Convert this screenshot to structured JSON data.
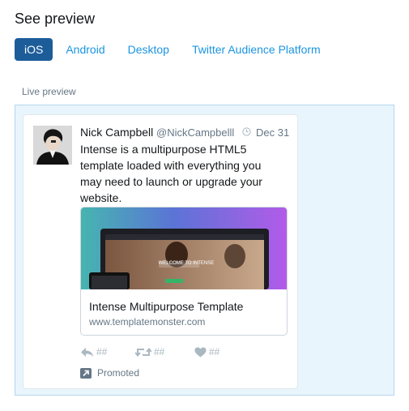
{
  "page": {
    "title": "See preview"
  },
  "tabs": [
    {
      "label": "iOS",
      "active": true
    },
    {
      "label": "Android",
      "active": false
    },
    {
      "label": "Desktop",
      "active": false
    },
    {
      "label": "Twitter Audience Platform",
      "active": false
    }
  ],
  "preview": {
    "label": "Live preview"
  },
  "tweet": {
    "name": "Nick Campbell",
    "handle": "@NickCampbelll",
    "date": "Dec 31",
    "text": "Intense is a multipurpose HTML5 template loaded with everything you may need to launch or upgrade your website.",
    "card": {
      "title": "Intense Multipurpose Template",
      "domain": "www.templatemonster.com",
      "image_text": "WELCOME TO INTENSE"
    },
    "actions": {
      "reply_count": "##",
      "retweet_count": "##",
      "like_count": "##"
    },
    "promoted_label": "Promoted"
  },
  "icons": {
    "reply": "reply-icon",
    "retweet": "retweet-icon",
    "like": "heart-icon",
    "promoted": "promoted-arrow-icon",
    "time": "clock-icon"
  },
  "colors": {
    "tab_active_bg": "#1c5d99",
    "link_blue": "#1b95e0",
    "preview_bg": "#e8f5fd",
    "card_gradient_start": "#3b6cc9",
    "card_gradient_end": "#a24de0"
  }
}
